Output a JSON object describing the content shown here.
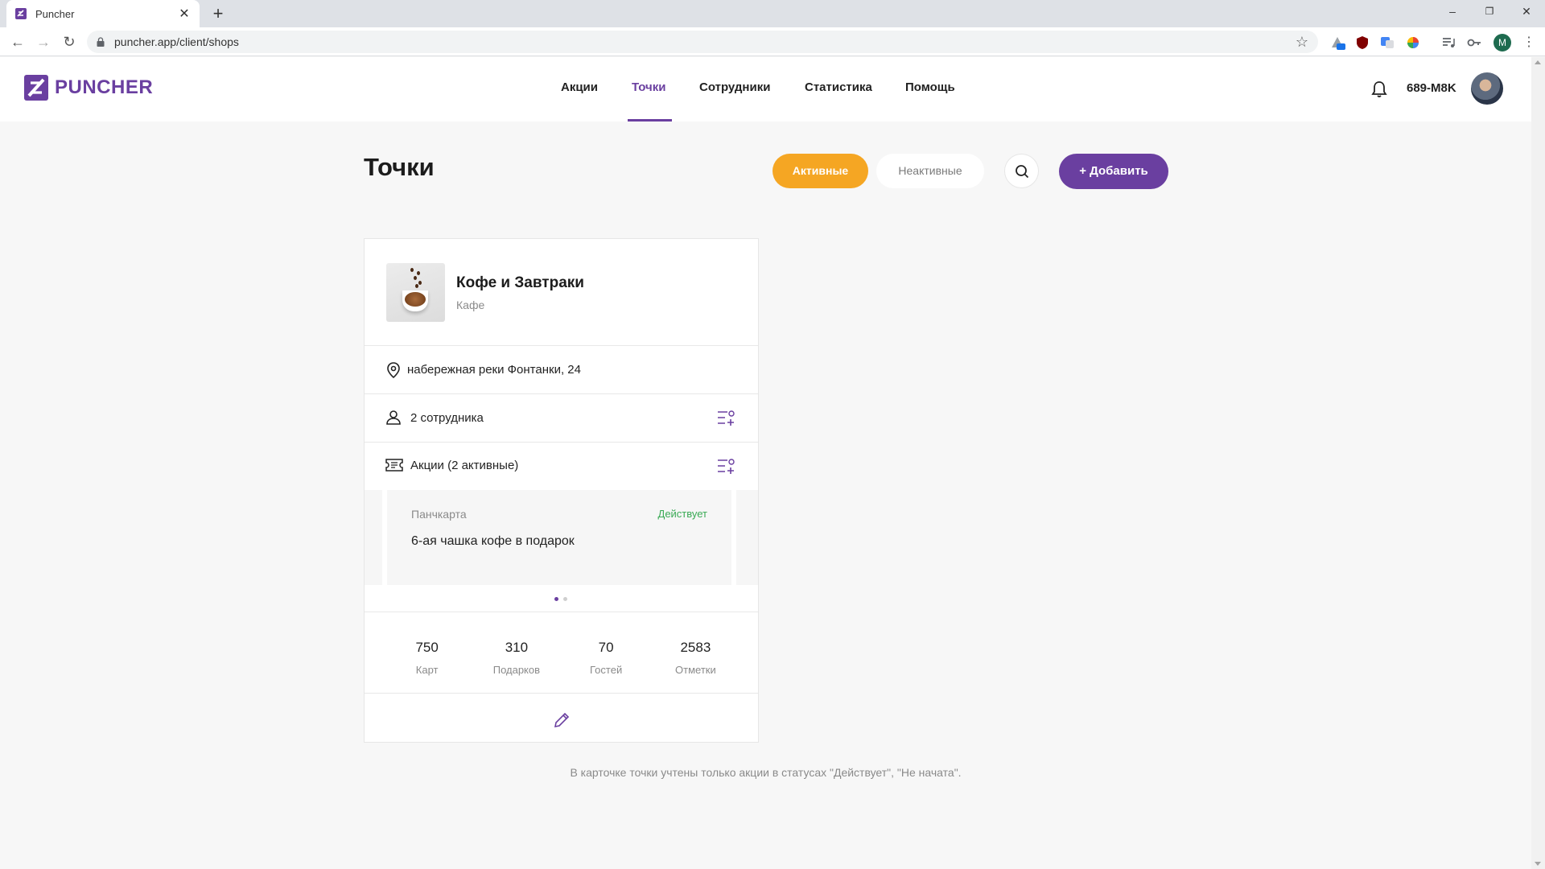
{
  "browser": {
    "tab_title": "Puncher",
    "tab_close": "✕",
    "new_tab": "+",
    "url": "puncher.app/client/shops",
    "profile_initial": "M",
    "win_minimize": "–",
    "win_restore": "❐",
    "win_close": "✕"
  },
  "header": {
    "logo_text": "PUNCHER",
    "nav": [
      "Акции",
      "Точки",
      "Сотрудники",
      "Статистика",
      "Помощь"
    ],
    "active_nav": "Точки",
    "user_code": "689-M8K"
  },
  "page": {
    "title": "Точки",
    "filter_active": "Активные",
    "filter_inactive": "Неактивные",
    "add_button": "+ Добавить"
  },
  "shop_card": {
    "name": "Кофе и Завтраки",
    "type": "Кафе",
    "address": "набережная реки Фонтанки, 24",
    "employees": "2 сотрудника",
    "promos_label": "Акции (2 активные)",
    "promo": {
      "type": "Панчкарта",
      "status": "Действует",
      "name": "6-ая чашка кофе в подарок"
    },
    "carousel_pages": 2,
    "carousel_current": 1,
    "stats": [
      {
        "value": "750",
        "label": "Карт"
      },
      {
        "value": "310",
        "label": "Подарков"
      },
      {
        "value": "70",
        "label": "Гостей"
      },
      {
        "value": "2583",
        "label": "Отметки"
      }
    ]
  },
  "footnote": "В карточке точки учтены только акции в статусах \"Действует\", \"Не начата\".",
  "colors": {
    "brand": "#6a3fa0",
    "accent_orange": "#f5a623",
    "status_green": "#3aaa55"
  },
  "icons": [
    "location-pin-icon",
    "users-icon",
    "ticket-icon",
    "list-add-icon",
    "pencil-icon",
    "bell-icon",
    "search-icon"
  ]
}
